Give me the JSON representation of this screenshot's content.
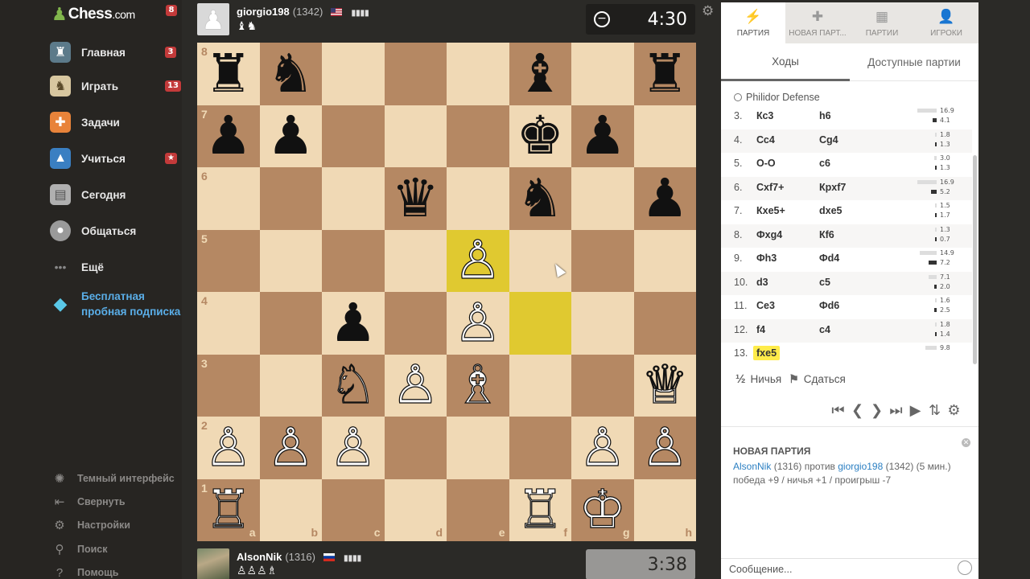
{
  "brand": {
    "name": "Chess",
    "dotcom": ".com",
    "badge": "8"
  },
  "sidebar": {
    "items": [
      {
        "label": "Главная",
        "badge": "3"
      },
      {
        "label": "Играть",
        "badge": "13"
      },
      {
        "label": "Задачи"
      },
      {
        "label": "Учиться",
        "badge": "★"
      },
      {
        "label": "Сегодня"
      },
      {
        "label": "Общаться"
      },
      {
        "label": "Ещё"
      },
      {
        "label_line1": "Бесплатная",
        "label_line2": "пробная подписка"
      }
    ],
    "bottom": [
      {
        "label": "Темный интерфейс"
      },
      {
        "label": "Свернуть"
      },
      {
        "label": "Настройки"
      },
      {
        "label": "Поиск"
      },
      {
        "label": "Помощь"
      }
    ]
  },
  "top_player": {
    "name": "giorgio198",
    "rating": "(1342)",
    "captured": "♝♞",
    "clock": "4:30"
  },
  "bottom_player": {
    "name": "AlsonNik",
    "rating": "(1316)",
    "captured": "♙♙♙♗",
    "clock": "3:38"
  },
  "board": {
    "ranks": [
      "8",
      "7",
      "6",
      "5",
      "4",
      "3",
      "2",
      "1"
    ],
    "files": [
      "a",
      "b",
      "c",
      "d",
      "e",
      "f",
      "g",
      "h"
    ],
    "position": [
      [
        "♜",
        "♞",
        "",
        "",
        "",
        "♝",
        "",
        "♜"
      ],
      [
        "♟",
        "♟",
        "",
        "",
        "",
        "♚",
        "♟",
        ""
      ],
      [
        "",
        "",
        "",
        "♛",
        "",
        "♞",
        "",
        "♟"
      ],
      [
        "",
        "",
        "",
        "",
        "♙",
        "",
        "",
        ""
      ],
      [
        "",
        "",
        "♟",
        "",
        "♙",
        "",
        "",
        ""
      ],
      [
        "",
        "",
        "♘",
        "♙",
        "♗",
        "",
        "",
        "♕"
      ],
      [
        "♙",
        "♙",
        "♙",
        "",
        "",
        "",
        "♙",
        "♙"
      ],
      [
        "♖",
        "",
        "",
        "",
        "",
        "♖",
        "♔",
        ""
      ]
    ]
  },
  "panel": {
    "tabs": [
      {
        "label": "ПАРТИЯ",
        "icon": "⚡"
      },
      {
        "label": "НОВАЯ ПАРТ...",
        "icon": "✚"
      },
      {
        "label": "ПАРТИИ",
        "icon": "▦"
      },
      {
        "label": "ИГРОКИ",
        "icon": "👤"
      }
    ],
    "subtabs": [
      "Ходы",
      "Доступные партии"
    ],
    "opening": "Philidor Defense",
    "moves": [
      {
        "num": "3.",
        "w": "Кс3",
        "b": "h6",
        "ew": "16.9",
        "eb": "4.1",
        "wbar": 24,
        "bbar": 5
      },
      {
        "num": "4.",
        "w": "Сс4",
        "b": "Сg4",
        "ew": "1.8",
        "eb": "1.3",
        "wbar": 2,
        "bbar": 2
      },
      {
        "num": "5.",
        "w": "O-O",
        "b": "c6",
        "ew": "3.0",
        "eb": "1.3",
        "wbar": 3,
        "bbar": 2
      },
      {
        "num": "6.",
        "w": "Сxf7+",
        "b": "Крxf7",
        "ew": "16.9",
        "eb": "5.2",
        "wbar": 24,
        "bbar": 7
      },
      {
        "num": "7.",
        "w": "Кxe5+",
        "b": "dxe5",
        "ew": "1.5",
        "eb": "1.7",
        "wbar": 2,
        "bbar": 2
      },
      {
        "num": "8.",
        "w": "Фxg4",
        "b": "Кf6",
        "ew": "1.3",
        "eb": "0.7",
        "wbar": 2,
        "bbar": 1
      },
      {
        "num": "9.",
        "w": "Фh3",
        "b": "Фd4",
        "ew": "14.9",
        "eb": "7.2",
        "wbar": 21,
        "bbar": 10
      },
      {
        "num": "10.",
        "w": "d3",
        "b": "c5",
        "ew": "7.1",
        "eb": "2.0",
        "wbar": 10,
        "bbar": 3
      },
      {
        "num": "11.",
        "w": "Сe3",
        "b": "Фd6",
        "ew": "1.6",
        "eb": "2.5",
        "wbar": 2,
        "bbar": 3
      },
      {
        "num": "12.",
        "w": "f4",
        "b": "c4",
        "ew": "1.8",
        "eb": "1.4",
        "wbar": 2,
        "bbar": 2
      },
      {
        "num": "13.",
        "w": "fxe5",
        "b": "",
        "ew": "9.8",
        "eb": "",
        "wbar": 14,
        "bbar": 0
      }
    ],
    "draw_label": "Ничья",
    "draw_icon": "½",
    "resign_label": "Сдаться",
    "resign_icon": "⚑",
    "controls": [
      "first",
      "prev",
      "next",
      "last",
      "play",
      "flip",
      "settings"
    ]
  },
  "chat": {
    "title": "НОВАЯ ПАРТИЯ",
    "player1": "AlsonNik",
    "rating1": "(1316)",
    "vs": "против",
    "player2": "giorgio198",
    "rating2": "(1342)",
    "time": "(5 мин.)",
    "result": "победа +9 / ничья +1 / проигрыш -7",
    "input_placeholder": "Сообщение..."
  },
  "colors": {
    "light_square": "#f0d9b5",
    "dark_square": "#b58863",
    "highlight": "#e0c930",
    "accent_blue": "#2b7fc2"
  }
}
